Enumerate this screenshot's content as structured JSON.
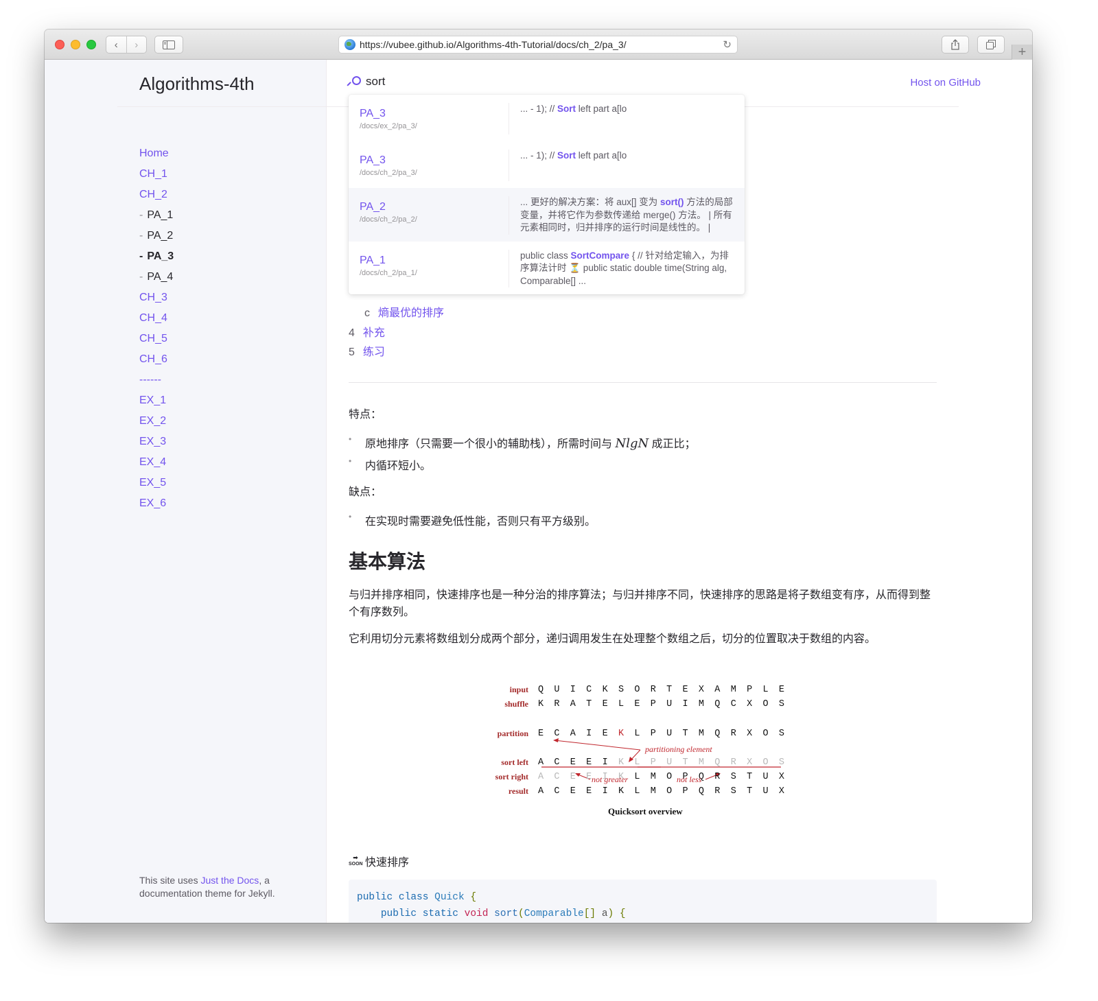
{
  "browser": {
    "url": "https://vubee.github.io/Algorithms-4th-Tutorial/docs/ch_2/pa_3/"
  },
  "sidebar": {
    "site_title": "Algorithms-4th",
    "nav": [
      {
        "label": "Home",
        "type": "link"
      },
      {
        "label": "CH_1",
        "type": "link"
      },
      {
        "label": "CH_2",
        "type": "link"
      },
      {
        "label": "PA_1",
        "type": "sub"
      },
      {
        "label": "PA_2",
        "type": "sub"
      },
      {
        "label": "PA_3",
        "type": "active"
      },
      {
        "label": "PA_4",
        "type": "sub"
      },
      {
        "label": "CH_3",
        "type": "link"
      },
      {
        "label": "CH_4",
        "type": "link"
      },
      {
        "label": "CH_5",
        "type": "link"
      },
      {
        "label": "CH_6",
        "type": "link"
      },
      {
        "label": "------",
        "type": "link"
      },
      {
        "label": "EX_1",
        "type": "link"
      },
      {
        "label": "EX_2",
        "type": "link"
      },
      {
        "label": "EX_3",
        "type": "link"
      },
      {
        "label": "EX_4",
        "type": "link"
      },
      {
        "label": "EX_5",
        "type": "link"
      },
      {
        "label": "EX_6",
        "type": "link"
      }
    ],
    "footer": {
      "prefix": "This site uses ",
      "link": "Just the Docs",
      "suffix": ", a documentation theme for Jekyll."
    }
  },
  "header": {
    "search_value": "sort",
    "host_link": "Host on GitHub"
  },
  "search_results": [
    {
      "title": "PA_3",
      "path": "/docs/ex_2/pa_3/",
      "snippet_before": "... - 1); // ",
      "match": "Sort",
      "snippet_after": " left part a[lo"
    },
    {
      "title": "PA_3",
      "path": "/docs/ch_2/pa_3/",
      "snippet_before": "... - 1); // ",
      "match": "Sort",
      "snippet_after": " left part a[lo"
    },
    {
      "title": "PA_2",
      "path": "/docs/ch_2/pa_2/",
      "snippet_before": "... 更好的解决方案：将 aux[] 变为 ",
      "match": "sort()",
      "snippet_after": " 方法的局部变量，并将它作为参数传递给 merge() 方法。 | 所有元素相同时，归并排序的运行时间是线性的。 |"
    },
    {
      "title": "PA_1",
      "path": "/docs/ch_2/pa_1/",
      "snippet_before": "public class ",
      "match": "SortCompare",
      "snippet_after": " { // 针对给定输入，为排序算法计时 ⏳ public static double time(String alg, Comparable[] ..."
    }
  ],
  "toc": [
    {
      "num": "c",
      "label": "熵最优的排序"
    },
    {
      "num": "4",
      "label": "补充"
    },
    {
      "num": "5",
      "label": "练习"
    }
  ],
  "content": {
    "features_title": "特点：",
    "feature_1_before": "原地排序（只需要一个很小的辅助栈），所需时间与 ",
    "feature_1_math": "NlgN",
    "feature_1_after": " 成正比；",
    "feature_2": "内循环短小。",
    "cons_title": "缺点：",
    "con_1": "在实现时需要避免低性能，否则只有平方级别。",
    "h2": "基本算法",
    "para_1": "与归并排序相同，快速排序也是一种分治的排序算法；与归并排序不同，快速排序的思路是将子数组变有序，从而得到整个有序数列。",
    "para_2": "它利用切分元素将数组划分成两个部分，递归调用发生在处理整个数组之后，切分的位置取决于数组的内容。",
    "soon_icon": "SOON",
    "soon_title": "快速排序",
    "code_line_1": [
      "public",
      "class",
      "Quick",
      "{"
    ],
    "code_line_2": [
      "public",
      "static",
      "void",
      "sort",
      "(",
      "Comparable",
      "[]",
      "a",
      ")",
      "{"
    ]
  },
  "figure": {
    "caption": "Quicksort overview",
    "rows": [
      {
        "label": "input",
        "letters": "QUICKSORTEXAMPLE",
        "gray": []
      },
      {
        "label": "shuffle",
        "letters": "KRATELEPUIMQCXOS",
        "gray": []
      },
      {
        "label": "partition",
        "letters": "ECAIEKLPUTMQRXOS",
        "gray": [],
        "red": [
          5
        ]
      },
      {
        "label": "sort left",
        "letters": "ACEEIKLPUTMQRXOS",
        "gray": [
          5,
          6,
          7,
          8,
          9,
          10,
          11,
          12,
          13,
          14,
          15
        ]
      },
      {
        "label": "sort right",
        "letters": "ACEEIKLMOPQRSTUX",
        "gray": [
          0,
          1,
          2,
          3,
          4,
          5
        ]
      },
      {
        "label": "result",
        "letters": "ACEEIKLMOPQRSTUX",
        "gray": []
      }
    ],
    "annotations": {
      "partitioning_element": "partitioning element",
      "not_greater": "not greater",
      "not_less": "not less"
    }
  }
}
